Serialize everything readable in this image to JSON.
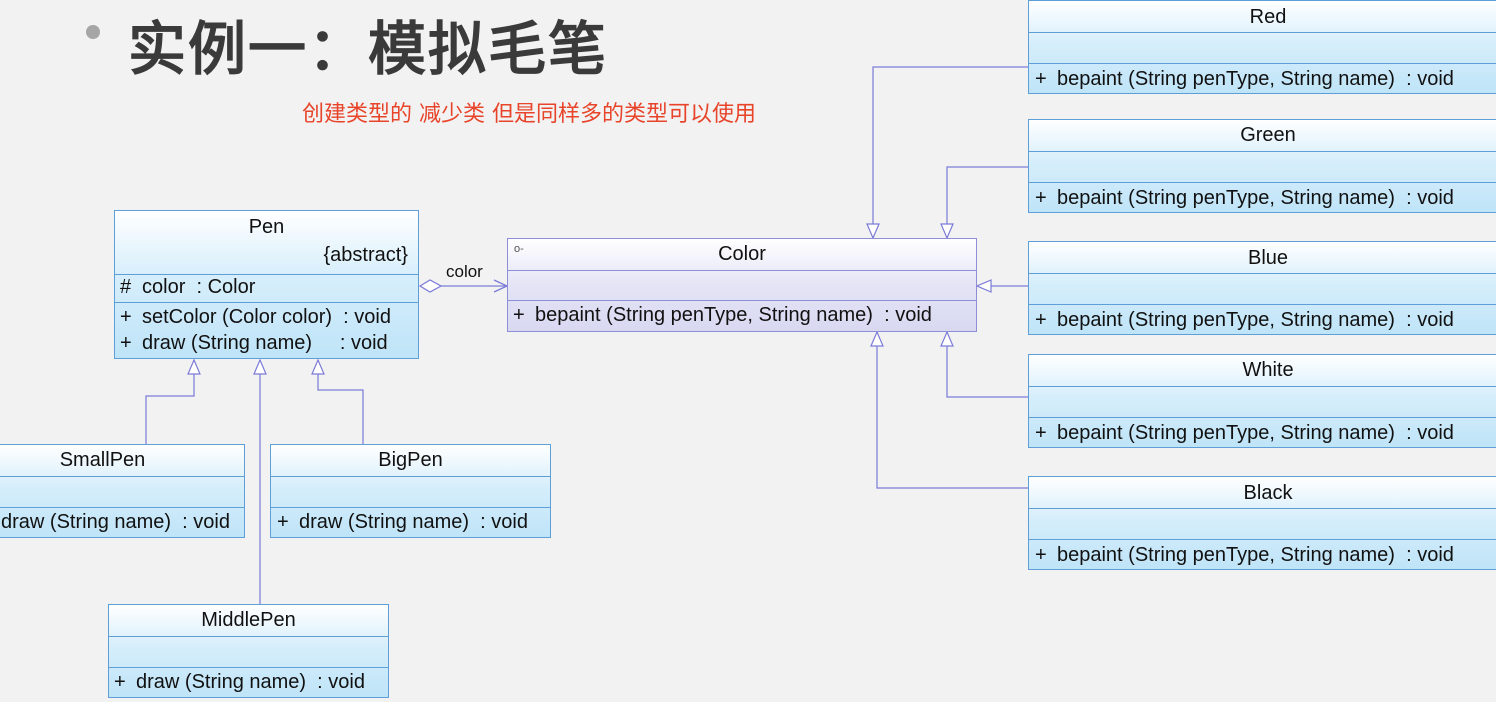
{
  "title": "实例一：模拟毛笔",
  "note": "创建类型的 减少类 但是同样多的类型可以使用",
  "association_label": "color",
  "pen": {
    "name": "Pen",
    "stereotype": "{abstract}",
    "attribute_vis": "#",
    "attribute": "color  : Color",
    "op1_vis": "+",
    "op1": "setColor (Color color)  : void",
    "op2_vis": "+",
    "op2": "draw (String name)     : void"
  },
  "color": {
    "name": "Color",
    "icon": "o-",
    "op_vis": "+",
    "op": "bepaint (String penType, String name)  : void"
  },
  "small_pen": {
    "name": "SmallPen",
    "op": "draw (String name)  : void"
  },
  "big_pen": {
    "name": "BigPen",
    "op_vis": "+",
    "op": "draw (String name)  : void"
  },
  "middle_pen": {
    "name": "MiddlePen",
    "op_vis": "+",
    "op": "draw (String name)  : void"
  },
  "concrete_colors": {
    "op_vis": "+",
    "op": "bepaint (String penType, String name)  : void",
    "red": "Red",
    "green": "Green",
    "blue": "Blue",
    "white": "White",
    "black": "Black"
  }
}
